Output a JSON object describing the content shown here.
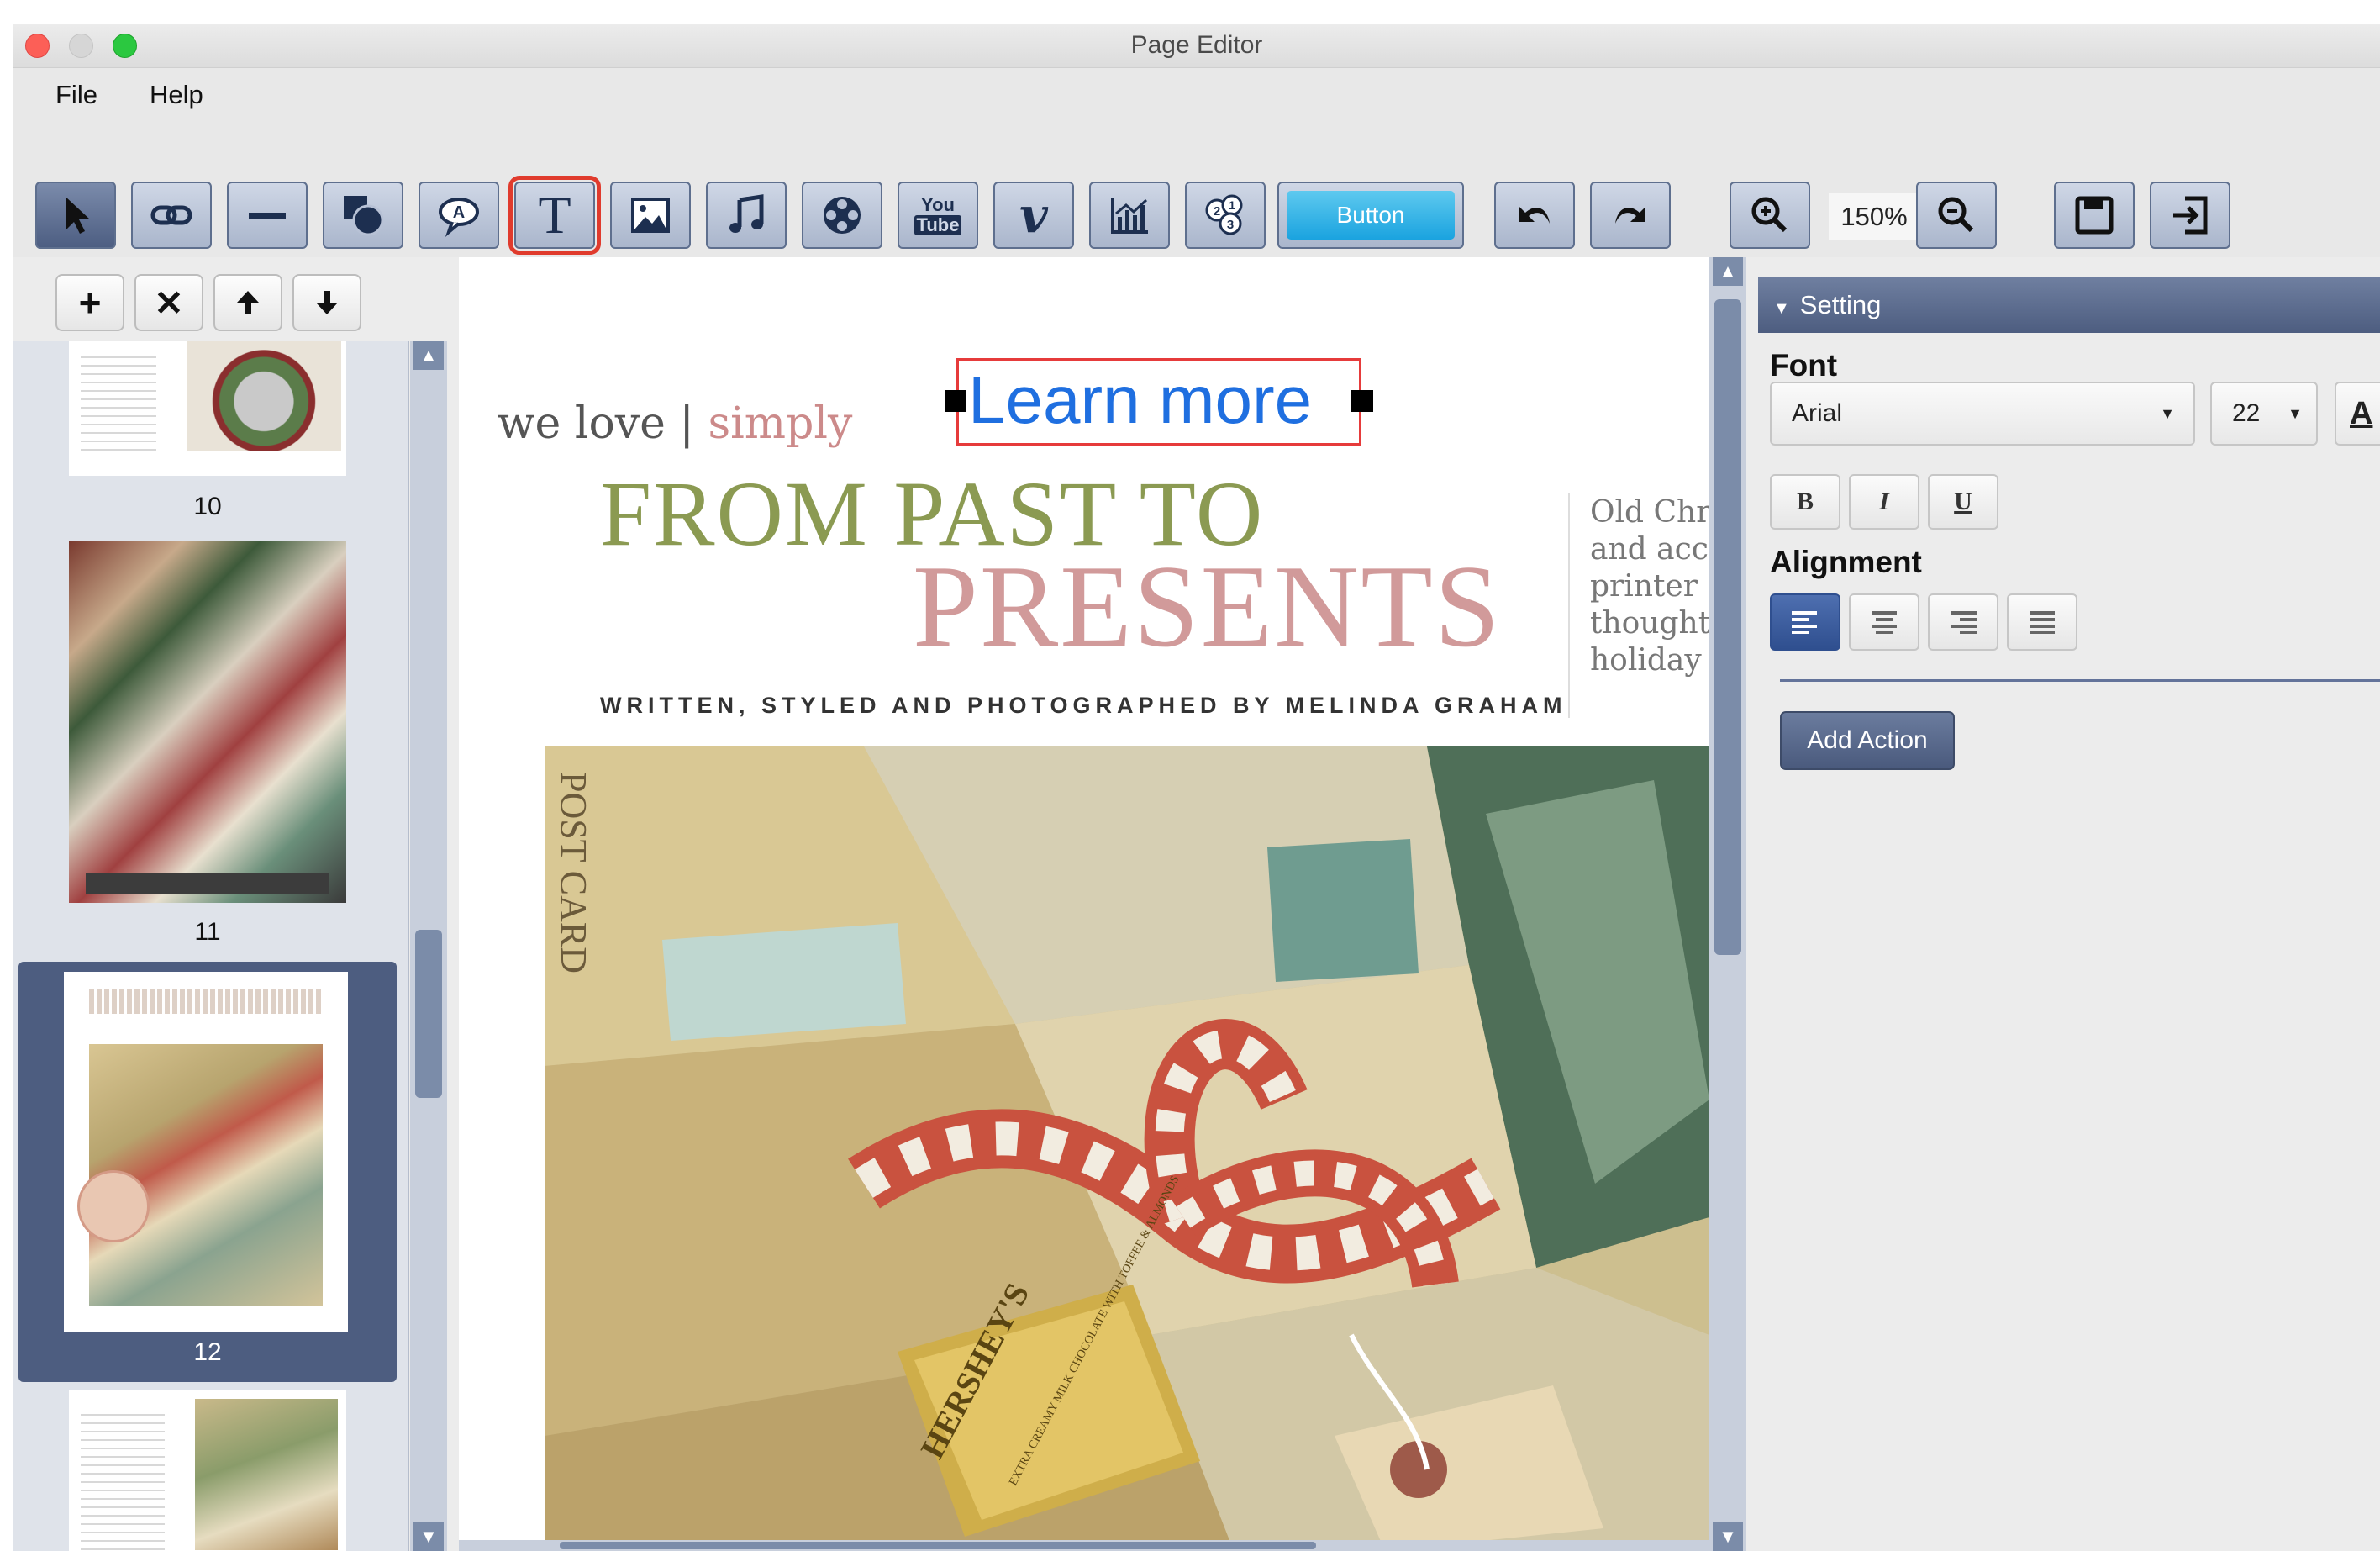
{
  "window": {
    "title": "Page Editor"
  },
  "menu": {
    "file": "File",
    "help": "Help"
  },
  "toolbar": {
    "tools": [
      {
        "name": "select-tool",
        "icon": "cursor-arrow-icon"
      },
      {
        "name": "link-tool",
        "icon": "link-icon"
      },
      {
        "name": "line-tool",
        "icon": "line-icon"
      },
      {
        "name": "shape-tool",
        "icon": "shapes-icon"
      },
      {
        "name": "callout-tool",
        "icon": "speech-bubble-icon"
      },
      {
        "name": "text-tool",
        "icon": "text-T-icon",
        "glyph": "T"
      },
      {
        "name": "image-tool",
        "icon": "image-icon"
      },
      {
        "name": "audio-tool",
        "icon": "music-note-icon"
      },
      {
        "name": "video-tool",
        "icon": "film-reel-icon"
      },
      {
        "name": "youtube-tool",
        "icon": "youtube-icon",
        "glyph_top": "You",
        "glyph_bottom": "Tube"
      },
      {
        "name": "vimeo-tool",
        "icon": "vimeo-icon",
        "glyph": "v"
      },
      {
        "name": "chart-tool",
        "icon": "chart-icon"
      },
      {
        "name": "slideshow-tool",
        "icon": "numbered-circles-icon"
      }
    ],
    "button_tool_label": "Button",
    "zoom_value": "150%"
  },
  "thumbnails": [
    {
      "page": "10"
    },
    {
      "page": "11"
    },
    {
      "page": "12",
      "selected": true
    },
    {
      "page": ""
    }
  ],
  "page": {
    "tagline_left": "we love |",
    "tagline_right": "simply",
    "learn_more": "Learn more",
    "heading_line1": "FROM PAST TO",
    "heading_line2": "PRESENTS",
    "byline": "WRITTEN, STYLED AND PHOTOGRAPHED BY MELINDA GRAHAM",
    "side_text": [
      "Old Chris",
      "and acce",
      "printer a",
      "thoughtf",
      "holiday a"
    ],
    "photo_texts": {
      "postcard": "POST CARD",
      "candy": "HERSHEY'S",
      "candy_sub": "EXTRA CREAMY MILK CHOCOLATE WITH TOFFEE & ALMONDS"
    }
  },
  "settings": {
    "header": "Setting",
    "font_label": "Font",
    "font_family": "Arial",
    "font_size": "22",
    "font_color_glyph": "A",
    "bold": "B",
    "italic": "I",
    "underline": "U",
    "alignment_label": "Alignment",
    "add_action": "Add Action"
  },
  "colors": {
    "accent": "#4d5d80",
    "selection_red": "#e63b3b",
    "link_blue": "#1f6fe0",
    "button_cyan": "#1aa3df",
    "heading_green": "#8b9a52",
    "heading_pink": "#d19a9a"
  }
}
